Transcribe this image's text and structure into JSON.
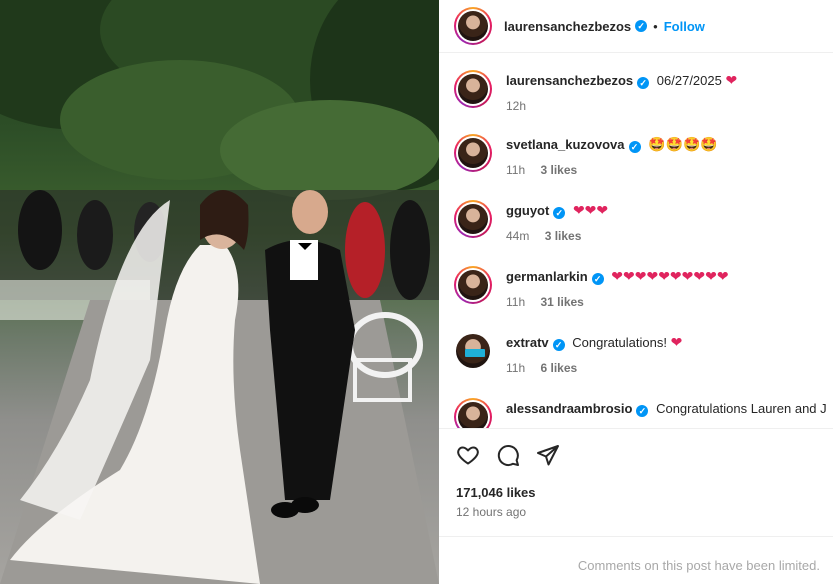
{
  "post": {
    "author": "laurensanchezbezos",
    "follow_label": "Follow",
    "dot": "•",
    "likes": "171,046 likes",
    "time_ago": "12 hours ago",
    "comments_limited": "Comments on this post have been limited."
  },
  "comments": [
    {
      "user": "laurensanchezbezos",
      "verified": true,
      "body": "06/27/2025",
      "emoji": "❤",
      "emoji_kind": "heart",
      "time": "12h",
      "likes": ""
    },
    {
      "user": "svetlana_kuzovova",
      "verified": true,
      "body": "",
      "emoji": "🤩🤩🤩🤩",
      "emoji_kind": "star",
      "time": "11h",
      "likes": "3 likes"
    },
    {
      "user": "gguyot",
      "verified": true,
      "body": "",
      "emoji": "❤❤❤",
      "emoji_kind": "heart",
      "time": "44m",
      "likes": "3 likes"
    },
    {
      "user": "germanlarkin",
      "verified": true,
      "body": "",
      "emoji": "❤❤❤❤❤❤❤❤❤❤",
      "emoji_kind": "heart",
      "time": "11h",
      "likes": "31 likes"
    },
    {
      "user": "extratv",
      "verified": true,
      "body": "Congratulations!",
      "emoji": "❤",
      "emoji_kind": "heart",
      "time": "11h",
      "likes": "6 likes"
    },
    {
      "user": "alessandraambrosio",
      "verified": true,
      "body": "Congratulations Lauren and J",
      "emoji": "",
      "emoji_kind": "",
      "time": "",
      "likes": ""
    }
  ],
  "icons": [
    "heart-icon",
    "comment-icon",
    "share-icon",
    "verified-badge-icon"
  ],
  "colors": {
    "accent": "#0095f6",
    "meta": "#737373",
    "heart": "#e0245e",
    "muted": "#a8a8a8"
  }
}
